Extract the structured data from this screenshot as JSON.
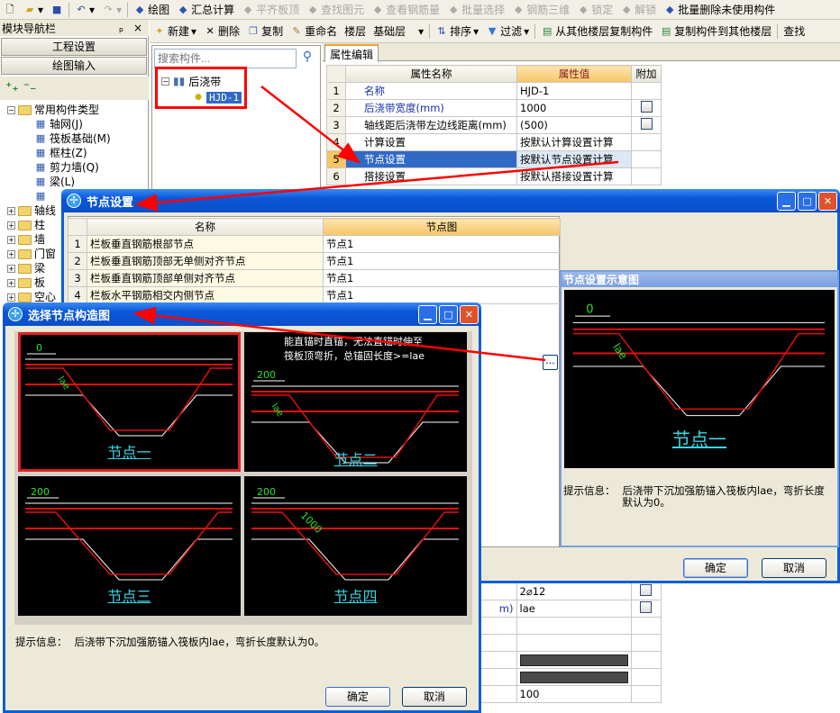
{
  "toolbar": {
    "items": [
      {
        "label": "绘图",
        "icon": "draw-icon",
        "enabled": true
      },
      {
        "label": "汇总计算",
        "icon": "sigma-icon",
        "enabled": true
      },
      {
        "label": "平齐板顶",
        "icon": "align-icon",
        "enabled": false
      },
      {
        "label": "查找图元",
        "icon": "find-icon",
        "enabled": false
      },
      {
        "label": "查看钢筋量",
        "icon": "view-rebar-icon",
        "enabled": false
      },
      {
        "label": "批量选择",
        "icon": "batch-select-icon",
        "enabled": false
      },
      {
        "label": "钢筋三维",
        "icon": "rebar-3d-icon",
        "enabled": false
      },
      {
        "label": "锁定",
        "icon": "lock-icon",
        "enabled": false
      },
      {
        "label": "解锁",
        "icon": "unlock-icon",
        "enabled": false
      },
      {
        "label": "批量删除未使用构件",
        "icon": "batch-delete-icon",
        "enabled": true
      }
    ]
  },
  "nav": {
    "title": "模块导航栏",
    "pin": "ᵖ",
    "close": "×",
    "buttons": [
      "工程设置",
      "绘图输入"
    ],
    "tree": {
      "root": "常用构件类型",
      "children": [
        "轴网(J)",
        "筏板基础(M)",
        "框柱(Z)",
        "剪力墙(Q)",
        "梁(L)",
        ""
      ],
      "folders": [
        "轴线",
        "柱",
        "墙",
        "门窗",
        "梁",
        "板",
        "空心"
      ]
    }
  },
  "toolbar2": {
    "new": "新建",
    "delete": "删除",
    "copy": "复制",
    "rename": "重命名",
    "floor_label": "楼层",
    "floor_value": "基础层",
    "sort": "排序",
    "filter": "过滤",
    "copy_from": "从其他楼层复制构件",
    "copy_to": "复制构件到其他楼层",
    "find": "查找"
  },
  "component_list": {
    "search_placeholder": "搜索构件...",
    "group": "后浇带",
    "item": "HJD-1"
  },
  "properties": {
    "tab": "属性编辑",
    "headers": [
      "属性名称",
      "属性值",
      "附加"
    ],
    "rows": [
      {
        "n": "1",
        "name": "名称",
        "value": "HJD-1",
        "blue": true,
        "check": false
      },
      {
        "n": "2",
        "name": "后浇带宽度(mm)",
        "value": "1000",
        "blue": true,
        "check": true
      },
      {
        "n": "3",
        "name": "轴线距后浇带左边线距离(mm)",
        "value": "(500)",
        "blue": false,
        "check": true
      },
      {
        "n": "4",
        "name": "计算设置",
        "value": "按默认计算设置计算",
        "blue": false,
        "check": false
      },
      {
        "n": "5",
        "name": "节点设置",
        "value": "按默认节点设置计算",
        "blue": false,
        "check": false,
        "selected": true
      },
      {
        "n": "6",
        "name": "搭接设置",
        "value": "按默认搭接设置计算",
        "blue": false,
        "check": false
      }
    ],
    "lower_rows": [
      {
        "name": "",
        "value": "2⌀12",
        "check": true
      },
      {
        "name": "m)",
        "value": "lae",
        "check": true
      },
      {
        "name": "",
        "value": ""
      },
      {
        "name": "",
        "value": ""
      },
      {
        "name": "",
        "value": "",
        "dark": true
      },
      {
        "name": "",
        "value": "",
        "dark": true
      },
      {
        "name": "",
        "value": "100"
      }
    ]
  },
  "node_dialog": {
    "title": "节点设置",
    "headers": [
      "名称",
      "节点图"
    ],
    "rows": [
      {
        "n": "1",
        "name": "栏板垂直钢筋根部节点",
        "value": "节点1"
      },
      {
        "n": "2",
        "name": "栏板垂直钢筋顶部无单侧对齐节点",
        "value": "节点1"
      },
      {
        "n": "3",
        "name": "栏板垂直钢筋顶部单侧对齐节点",
        "value": "节点1"
      },
      {
        "n": "4",
        "name": "栏板水平钢筋相交内侧节点",
        "value": "节点1"
      }
    ],
    "ellipsis": "...",
    "preview_title": "节点设置示意图",
    "preview_caption": "节点一",
    "preview_dim": "0",
    "preview_lae": "lae",
    "hint_label": "提示信息：",
    "hint": "后浇带下沉加强筋锚入筏板内lae，弯折长度默认为0。",
    "ok": "确定",
    "cancel": "取消"
  },
  "choose_dialog": {
    "title": "选择节点构造图",
    "options": [
      {
        "caption": "节点一",
        "dim": "0",
        "lae": "lae",
        "selected": true
      },
      {
        "caption": "节点二",
        "dim": "200",
        "lae": "lae",
        "note1": "能直锚时直锚，无法直锚时伸至",
        "note2": "筏板顶弯折，总锚固长度>=lae"
      },
      {
        "caption": "节点三",
        "dim": "200"
      },
      {
        "caption": "节点四",
        "dim": "200",
        "len": "1000"
      }
    ],
    "hint_label": "提示信息：",
    "hint": "后浇带下沉加强筋锚入筏板内lae，弯折长度默认为0。",
    "ok": "确定",
    "cancel": "取消"
  },
  "colors": {
    "accent": "#0a57d8",
    "selection": "#316ac5",
    "annotation": "#ff0000",
    "rebar": "#e01010",
    "caption": "#39d6e6"
  }
}
